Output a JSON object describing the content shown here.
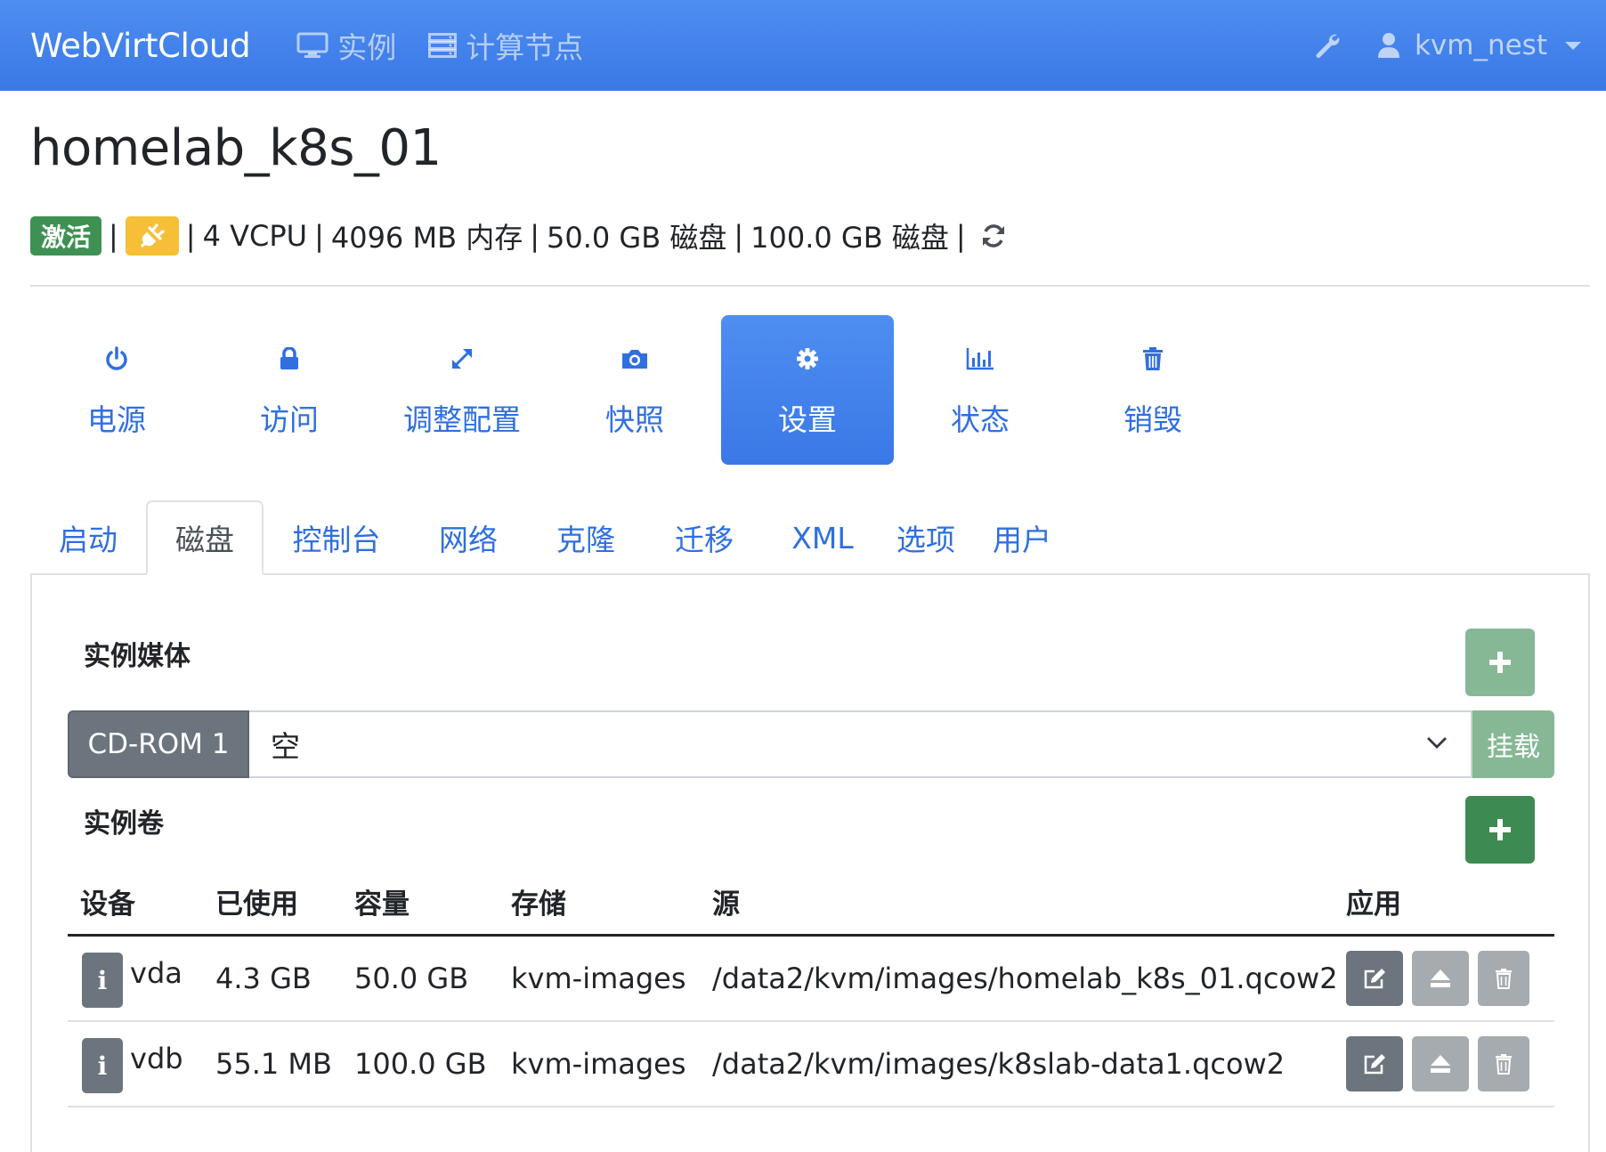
{
  "navbar": {
    "brand": "WebVirtCloud",
    "links": [
      {
        "label": "实例",
        "icon": "desktop-icon"
      },
      {
        "label": "计算节点",
        "icon": "server-icon"
      }
    ],
    "settings_icon": "wrench-icon",
    "user": {
      "name": "kvm_nest",
      "icon": "user-icon"
    }
  },
  "instance": {
    "name": "homelab_k8s_01",
    "status_badge": "激活",
    "power_icon": "plug-icon",
    "vcpu": "4 VCPU",
    "memory": "4096 MB 内存",
    "disk1": "50.0 GB 磁盘",
    "disk2": "100.0 GB 磁盘",
    "separator": "|",
    "refresh_icon": "refresh-icon"
  },
  "actions": [
    {
      "label": "电源",
      "icon": "power-icon",
      "active": false
    },
    {
      "label": "访问",
      "icon": "lock-icon",
      "active": false
    },
    {
      "label": "调整配置",
      "icon": "resize-icon",
      "active": false
    },
    {
      "label": "快照",
      "icon": "camera-icon",
      "active": false
    },
    {
      "label": "设置",
      "icon": "gear-icon",
      "active": true
    },
    {
      "label": "状态",
      "icon": "bar-chart-icon",
      "active": false
    },
    {
      "label": "销毁",
      "icon": "trash-icon",
      "active": false
    }
  ],
  "tabs": [
    {
      "label": "启动",
      "active": false
    },
    {
      "label": "磁盘",
      "active": true
    },
    {
      "label": "控制台",
      "active": false
    },
    {
      "label": "网络",
      "active": false
    },
    {
      "label": "克隆",
      "active": false
    },
    {
      "label": "迁移",
      "active": false
    },
    {
      "label": "XML",
      "active": false
    },
    {
      "label": "选项",
      "active": false
    },
    {
      "label": "用户",
      "active": false
    }
  ],
  "media": {
    "title": "实例媒体",
    "cdrom_label": "CD-ROM 1",
    "selected": "空",
    "mount_label": "挂载"
  },
  "volumes": {
    "title": "实例卷",
    "columns": [
      "设备",
      "已使用",
      "容量",
      "存储",
      "源",
      "应用"
    ],
    "rows": [
      {
        "device": "vda",
        "used": "4.3 GB",
        "capacity": "50.0 GB",
        "storage": "kvm-images",
        "source": "/data2/kvm/images/homelab_k8s_01.qcow2"
      },
      {
        "device": "vdb",
        "used": "55.1 MB",
        "capacity": "100.0 GB",
        "storage": "kvm-images",
        "source": "/data2/kvm/images/k8slab-data1.qcow2"
      }
    ],
    "info_glyph": "i"
  },
  "colors": {
    "primary": "#3a78e7",
    "success": "#3e8a53",
    "success_light": "#86b896",
    "warning": "#f6bf37",
    "secondary": "#6c757d"
  }
}
